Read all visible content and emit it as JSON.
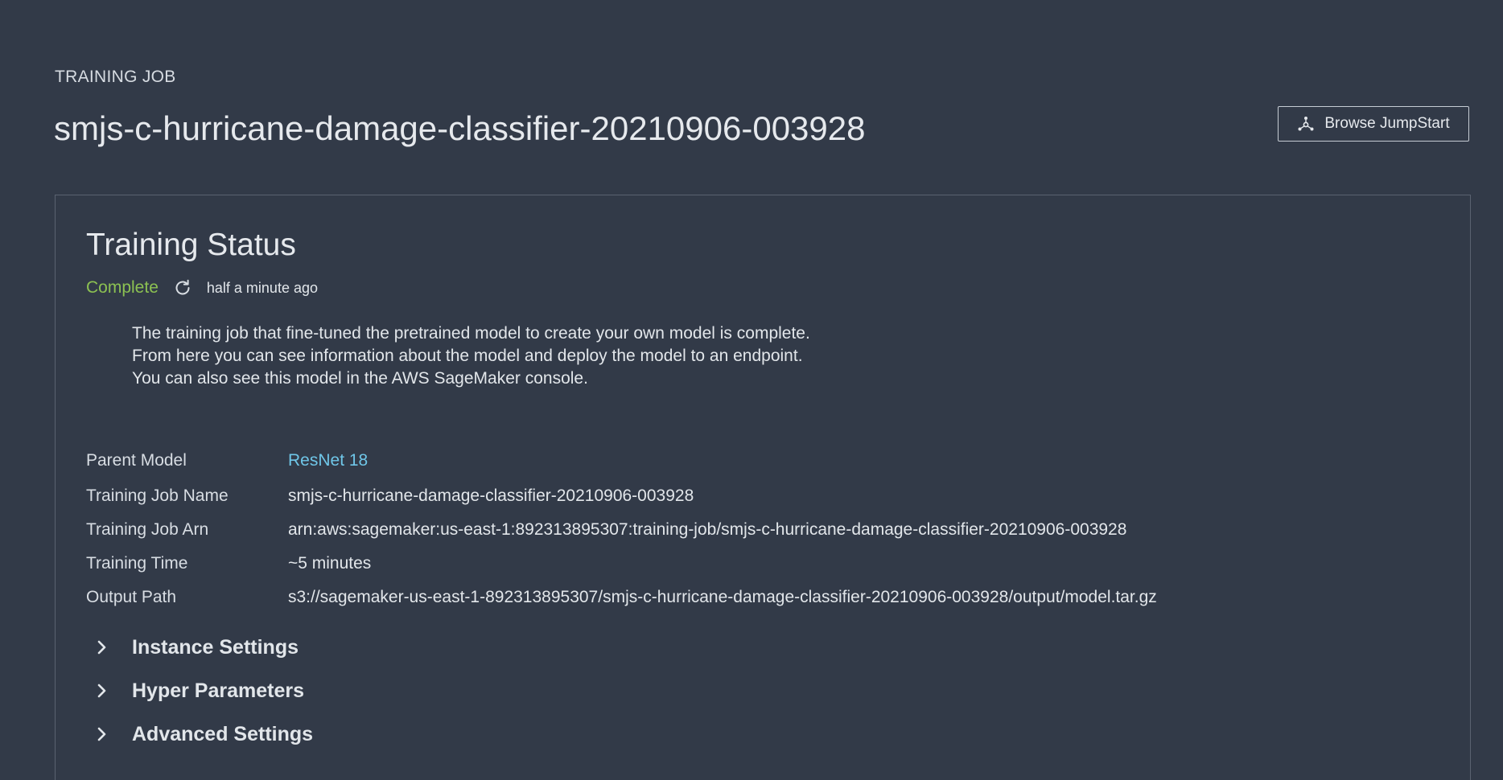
{
  "header": {
    "eyebrow": "TRAINING JOB",
    "title": "smjs-c-hurricane-damage-classifier-20210906-003928",
    "browse_button": {
      "label": "Browse JumpStart",
      "icon": "jumpstart-icon"
    }
  },
  "status_card": {
    "title": "Training Status",
    "status": "Complete",
    "status_color": "#8cc152",
    "refresh_icon": "refresh-icon",
    "updated": "half a minute ago",
    "description": [
      "The training job that fine-tuned the pretrained model to create your own model is complete.",
      "From here you can see information about the model and deploy the model to an endpoint.",
      "You can also see this model in the AWS SageMaker console."
    ],
    "details": [
      {
        "label": "Parent Model",
        "value": "ResNet 18"
      },
      {
        "label": "Training Job Name",
        "value": "smjs-c-hurricane-damage-classifier-20210906-003928"
      },
      {
        "label": "Training Job Arn",
        "value": "arn:aws:sagemaker:us-east-1:892313895307:training-job/smjs-c-hurricane-damage-classifier-20210906-003928"
      },
      {
        "label": "Training Time",
        "value": "~5 minutes"
      },
      {
        "label": "Output Path",
        "value": "s3://sagemaker-us-east-1-892313895307/smjs-c-hurricane-damage-classifier-20210906-003928/output/model.tar.gz"
      }
    ],
    "link_color": "#6fc6e8",
    "sections": [
      {
        "label": "Instance Settings",
        "expanded": false
      },
      {
        "label": "Hyper Parameters",
        "expanded": false
      },
      {
        "label": "Advanced Settings",
        "expanded": false
      }
    ]
  }
}
